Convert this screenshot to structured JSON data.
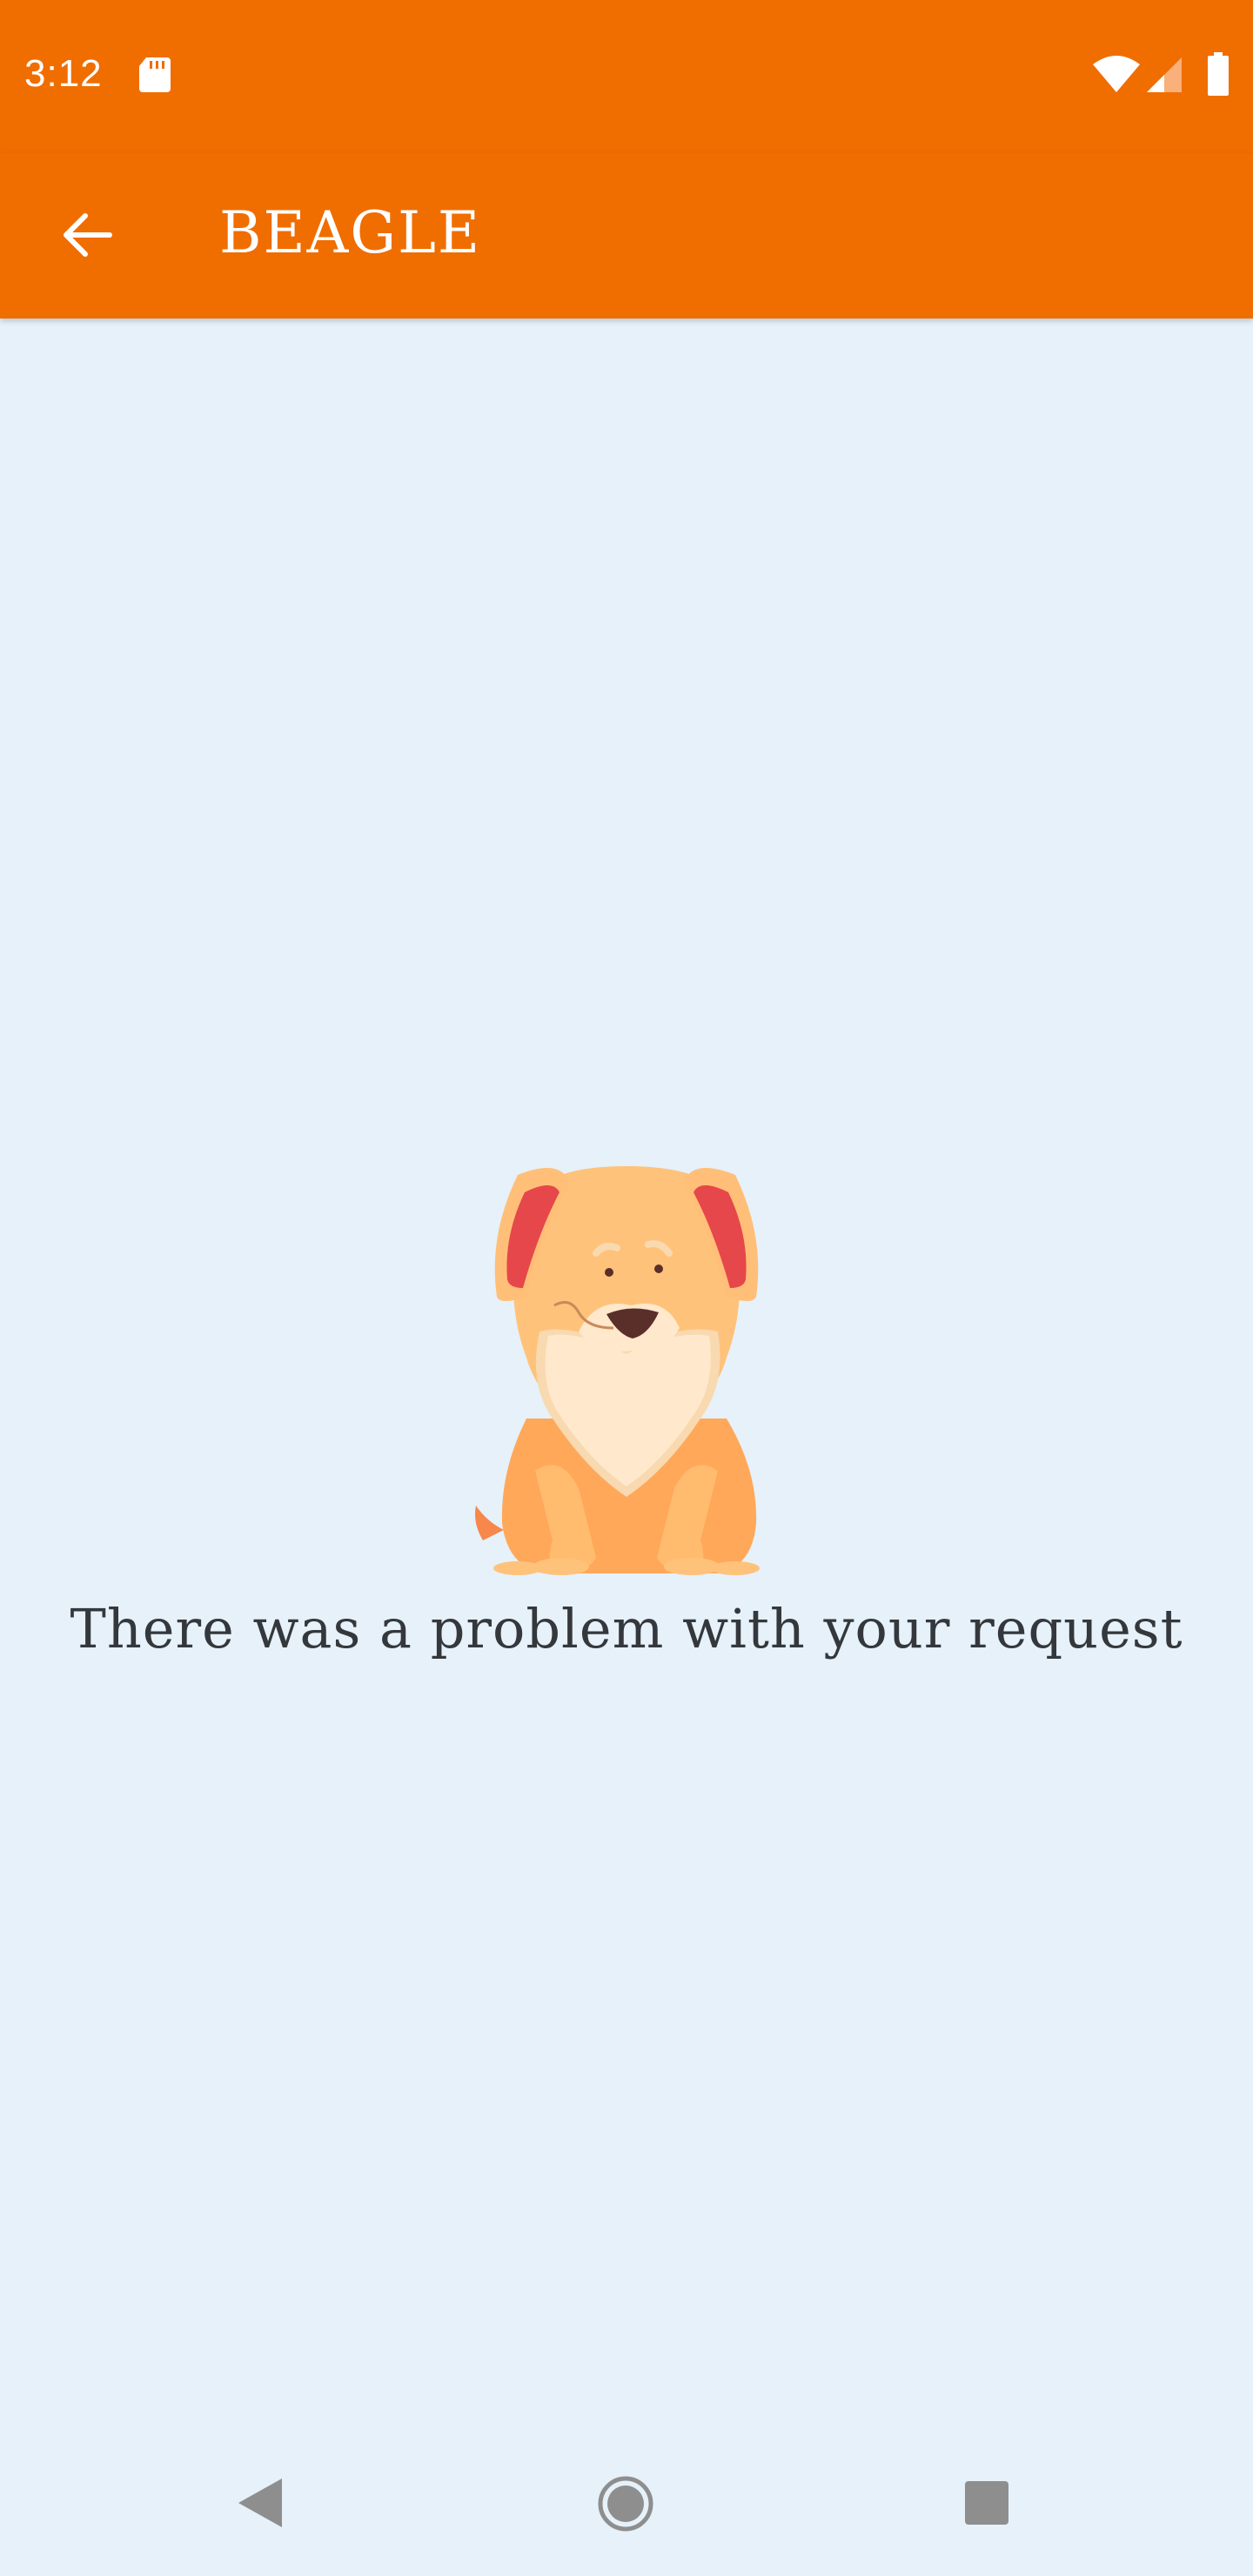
{
  "status_bar": {
    "time": "3:12",
    "icons": [
      "sd-card-icon",
      "wifi-icon",
      "signal-icon",
      "battery-icon"
    ]
  },
  "app_bar": {
    "title": "BEAGLE",
    "back_icon": "arrow-back-icon"
  },
  "main": {
    "illustration": "sad-dog-illustration",
    "error_message": "There was a problem with your request"
  },
  "nav_bar": {
    "icons": [
      "nav-back-icon",
      "nav-home-icon",
      "nav-recents-icon"
    ]
  },
  "colors": {
    "primary": "#f06d00",
    "background": "#e6f1f9",
    "text": "#34383c",
    "nav_icon": "#8e8e8e"
  }
}
